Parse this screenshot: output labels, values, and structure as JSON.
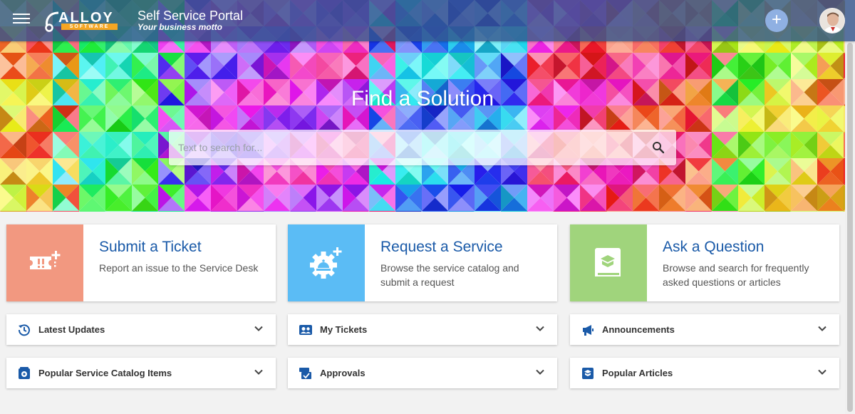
{
  "header": {
    "logo_word": "ALLOY",
    "logo_sub": "SOFTWARE",
    "title": "Self Service Portal",
    "motto": "Your business motto",
    "add_symbol": "+"
  },
  "hero": {
    "title": "Find a Solution",
    "search_placeholder": "Text to search for..."
  },
  "cards": [
    {
      "title": "Submit a Ticket",
      "description": "Report an issue to the Service Desk",
      "color": "#f29880",
      "icon": "ticket-icon"
    },
    {
      "title": "Request a Service",
      "description": "Browse the service catalog and submit a request",
      "color": "#5bbcf5",
      "icon": "service-gear-icon"
    },
    {
      "title": "Ask a Question",
      "description": "Browse and search for frequently asked questions or articles",
      "color": "#a0d47c",
      "icon": "knowledge-book-icon"
    }
  ],
  "panels": [
    {
      "label": "Latest Updates",
      "icon": "history-icon"
    },
    {
      "label": "My Tickets",
      "icon": "id-card-icon"
    },
    {
      "label": "Announcements",
      "icon": "megaphone-icon"
    },
    {
      "label": "Popular Service Catalog Items",
      "icon": "catalog-icon"
    },
    {
      "label": "Approvals",
      "icon": "approvals-icon"
    },
    {
      "label": "Popular Articles",
      "icon": "articles-icon"
    }
  ],
  "colors": {
    "accent": "#1a5aa8",
    "header_bg": "#34568c"
  }
}
